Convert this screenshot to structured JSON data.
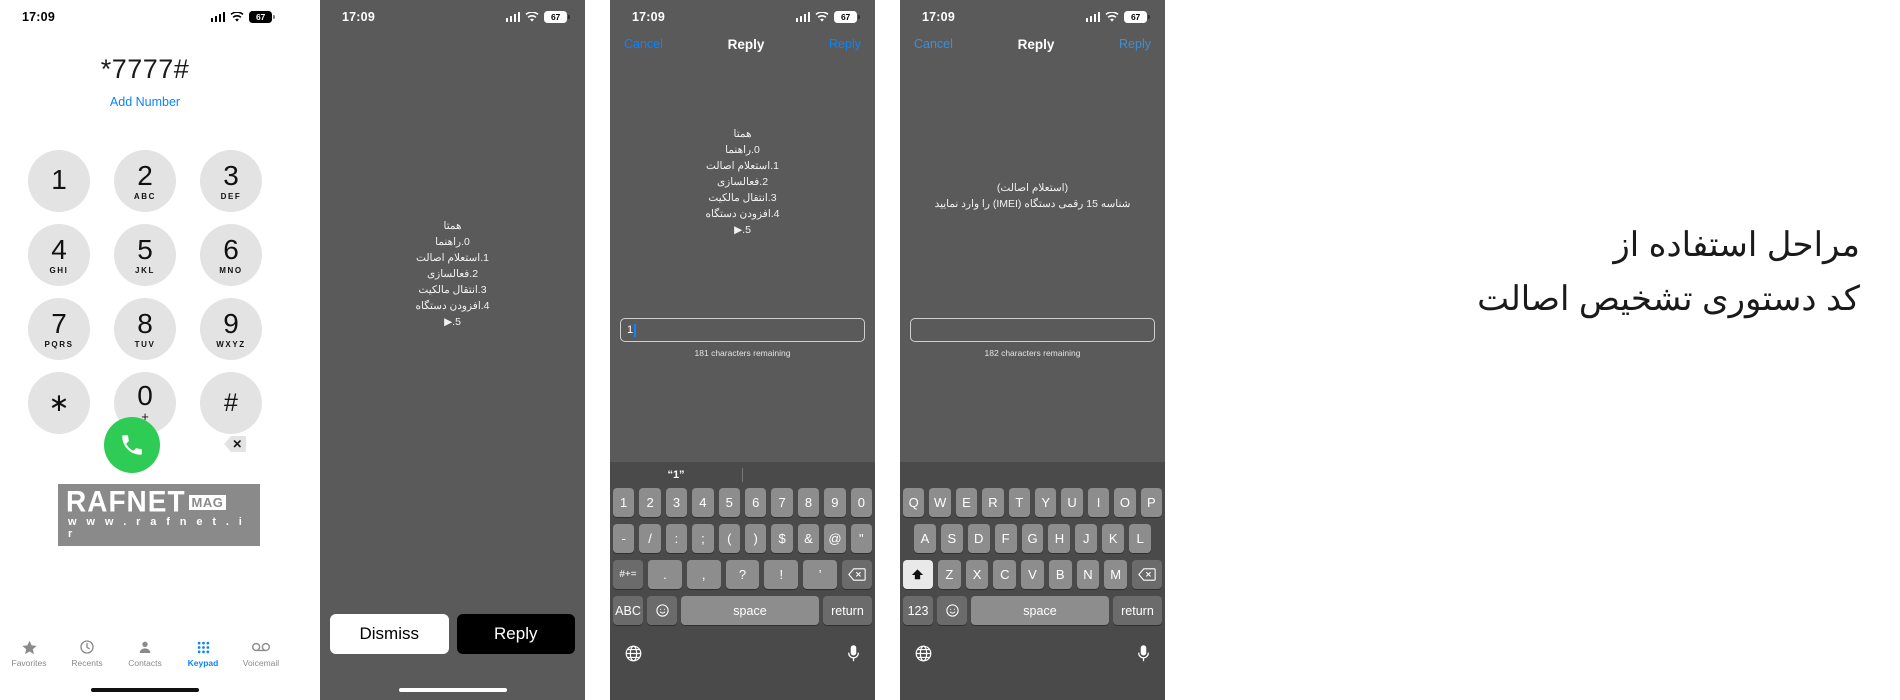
{
  "status_bar": {
    "time": "17:09",
    "battery": "67",
    "wifi_icon": "wifi-icon",
    "signal_icon": "cellular-signal-icon",
    "battery_icon": "battery-icon"
  },
  "panel1": {
    "name": "dialer-screen",
    "dialed_number": "*7777#",
    "add_number_label": "Add Number",
    "keys": [
      {
        "digit": "1",
        "letters": ""
      },
      {
        "digit": "2",
        "letters": "ABC"
      },
      {
        "digit": "3",
        "letters": "DEF"
      },
      {
        "digit": "4",
        "letters": "GHI"
      },
      {
        "digit": "5",
        "letters": "JKL"
      },
      {
        "digit": "6",
        "letters": "MNO"
      },
      {
        "digit": "7",
        "letters": "PQRS"
      },
      {
        "digit": "8",
        "letters": "TUV"
      },
      {
        "digit": "9",
        "letters": "WXYZ"
      },
      {
        "digit": "∗",
        "letters": ""
      },
      {
        "digit": "0",
        "letters": "+"
      },
      {
        "digit": "#",
        "letters": ""
      }
    ],
    "call_button_icon": "phone-call-icon",
    "call_button_color": "#2ecc55",
    "delete_button_icon": "backspace-delete-icon",
    "watermark": {
      "brand": "RAFNET",
      "badge": "MAG",
      "url": "w w w . r a f n e t . i r"
    },
    "tabs": [
      {
        "label": "Favorites",
        "icon": "star-icon",
        "active": false
      },
      {
        "label": "Recents",
        "icon": "clock-icon",
        "active": false
      },
      {
        "label": "Contacts",
        "icon": "contacts-icon",
        "active": false
      },
      {
        "label": "Keypad",
        "icon": "keypad-icon",
        "active": true
      },
      {
        "label": "Voicemail",
        "icon": "voicemail-icon",
        "active": false
      }
    ],
    "accent_color": "#0a84ff"
  },
  "panel2": {
    "name": "ussd-response-alert",
    "message_lines": [
      "همتا",
      "0.راهنما",
      "1.استعلام اصالت",
      "2.فعالسازی",
      "3.انتقال مالکیت",
      "4.افزودن دستگاه",
      "5.▶"
    ],
    "dismiss_label": "Dismiss",
    "reply_label": "Reply"
  },
  "panel3": {
    "name": "ussd-reply-numeric-keyboard",
    "nav": {
      "cancel": "Cancel",
      "title": "Reply",
      "send": "Reply"
    },
    "message_lines": [
      "همتا",
      "0.راهنما",
      "1.استعلام اصالت",
      "2.فعالسازی",
      "3.انتقال مالکیت",
      "4.افزودن دستگاه",
      "5.▶"
    ],
    "input_value": "1",
    "char_count": "181 characters remaining",
    "predictive": "“1”",
    "keyboard": {
      "row1": [
        "1",
        "2",
        "3",
        "4",
        "5",
        "6",
        "7",
        "8",
        "9",
        "0"
      ],
      "row2": [
        "-",
        "/",
        ":",
        ";",
        "(",
        ")",
        "$",
        "&",
        "@",
        "\""
      ],
      "row3_left": "#+=",
      "row3": [
        ".",
        ",",
        "?",
        "!",
        "’"
      ],
      "row3_right_icon": "backspace-icon",
      "mode_key": "ABC",
      "emoji_icon": "emoji-icon",
      "space_label": "space",
      "return_label": "return",
      "globe_icon": "globe-icon",
      "mic_icon": "microphone-icon"
    }
  },
  "panel4": {
    "name": "ussd-reply-imei-keyboard",
    "nav": {
      "cancel": "Cancel",
      "title": "Reply",
      "send": "Reply"
    },
    "message_lines": [
      "(استعلام اصالت)",
      "شناسه 15 رقمی دستگاه (IMEI) را وارد نمایید"
    ],
    "input_value": "",
    "char_count": "182 characters remaining",
    "keyboard": {
      "row1": [
        "Q",
        "W",
        "E",
        "R",
        "T",
        "Y",
        "U",
        "I",
        "O",
        "P"
      ],
      "row2": [
        "A",
        "S",
        "D",
        "F",
        "G",
        "H",
        "J",
        "K",
        "L"
      ],
      "row3": [
        "Z",
        "X",
        "C",
        "V",
        "B",
        "N",
        "M"
      ],
      "shift_icon": "shift-icon",
      "backspace_icon": "backspace-icon",
      "mode_key": "123",
      "emoji_icon": "emoji-icon",
      "space_label": "space",
      "return_label": "return",
      "globe_icon": "globe-icon",
      "mic_icon": "microphone-icon"
    }
  },
  "caption": {
    "name": "article-caption",
    "line1": "مراحل استفاده از",
    "line2": "کد دستوری تشخیص اصالت"
  }
}
